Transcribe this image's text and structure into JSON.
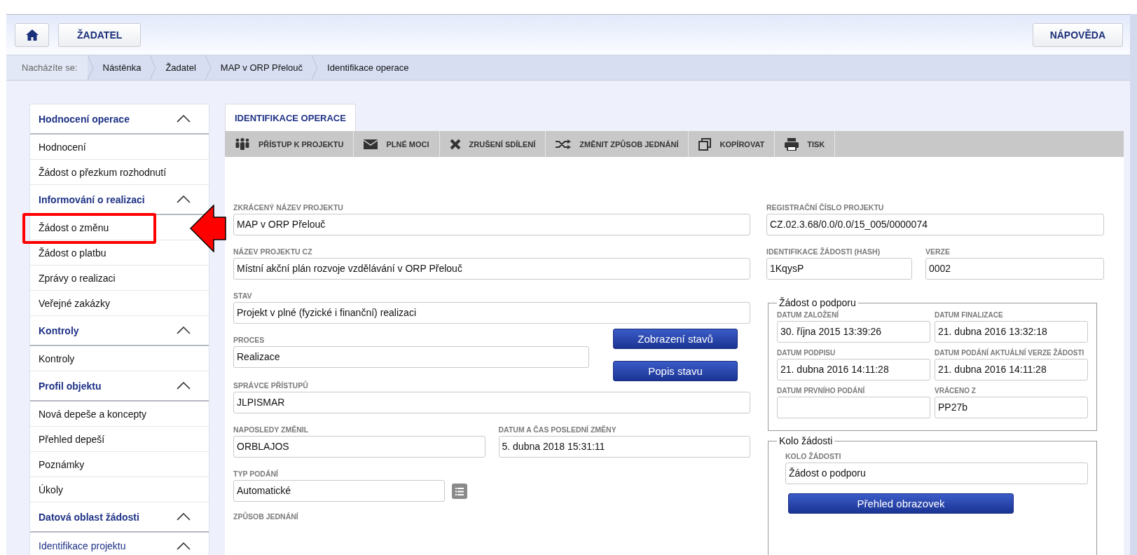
{
  "header": {
    "buttons": [
      "ŽADATEL"
    ],
    "help": "NÁPOVĚDA"
  },
  "breadcrumb": {
    "label": "Nacházíte se:",
    "items": [
      "Nástěnka",
      "Žadatel",
      "MAP v ORP Přelouč",
      "Identifikace operace"
    ]
  },
  "sidebar": {
    "sections": [
      {
        "title": "Hodnocení operace",
        "expanded": true,
        "items": [
          {
            "label": "Hodnocení",
            "highlighted": false
          },
          {
            "label": "Žádost o přezkum rozhodnutí",
            "highlighted": false
          }
        ]
      },
      {
        "title": "Informování o realizaci",
        "expanded": true,
        "items": [
          {
            "label": "Žádost o změnu",
            "highlighted": true
          },
          {
            "label": "Žádost o platbu",
            "highlighted": false
          },
          {
            "label": "Zprávy o realizaci",
            "highlighted": false
          },
          {
            "label": "Veřejné zakázky",
            "highlighted": false
          }
        ]
      },
      {
        "title": "Kontroly",
        "expanded": true,
        "items": [
          {
            "label": "Kontroly",
            "highlighted": false
          }
        ]
      },
      {
        "title": "Profil objektu",
        "expanded": true,
        "items": [
          {
            "label": "Nová depeše a koncepty",
            "highlighted": false
          },
          {
            "label": "Přehled depeší",
            "highlighted": false
          },
          {
            "label": "Poznámky",
            "highlighted": false
          },
          {
            "label": "Úkoly",
            "highlighted": false
          }
        ]
      },
      {
        "title": "Datová oblast žádosti",
        "expanded": true,
        "items": [
          {
            "label": "Identifikace projektu",
            "kind": "group",
            "expanded": true
          }
        ]
      }
    ]
  },
  "form": {
    "tab": "IDENTIFIKACE OPERACE",
    "toolbar": [
      "PŘÍSTUP K PROJEKTU",
      "PLNÉ MOCI",
      "ZRUŠENÍ SDÍLENÍ",
      "ZMĚNIT ZPŮSOB JEDNÁNÍ",
      "KOPÍROVAT",
      "TISK"
    ],
    "short_name": {
      "label": "ZKRÁCENÝ NÁZEV PROJEKTU",
      "value": "MAP v ORP Přelouč"
    },
    "name_cz": {
      "label": "NÁZEV PROJEKTU CZ",
      "value": "Místní akční plán rozvoje vzdělávání v ORP Přelouč"
    },
    "state": {
      "label": "STAV",
      "value": "Projekt v plné (fyzické i finanční) realizaci"
    },
    "process": {
      "label": "PROCES",
      "value": "Realizace"
    },
    "state_buttons": [
      "Zobrazení stavů",
      "Popis stavu"
    ],
    "access_manager": {
      "label": "SPRÁVCE PŘÍSTUPŮ",
      "value": "JLPISMAR"
    },
    "last_changed_by": {
      "label": "NAPOSLEDY ZMĚNIL",
      "value": "ORBLAJOS"
    },
    "last_change": {
      "label": "DATUM A ČAS POSLEDNÍ ZMĚNY",
      "value": "5. dubna 2018 15:31:11"
    },
    "submission_type": {
      "label": "TYP PODÁNÍ",
      "value": "Automatické"
    },
    "method_label": "ZPŮSOB JEDNÁNÍ",
    "reg_number": {
      "label": "REGISTRAČNÍ ČÍSLO PROJEKTU",
      "value": "CZ.02.3.68/0.0/0.0/15_005/0000074"
    },
    "request_hash": {
      "label": "IDENTIFIKACE ŽÁDOSTI (HASH)",
      "value": "1KqysP"
    },
    "version": {
      "label": "VERZE",
      "value": "0002"
    },
    "support": {
      "legend": "Žádost o podporu",
      "fields": [
        {
          "label": "DATUM ZALOŽENÍ",
          "value": "30. října 2015 13:39:26"
        },
        {
          "label": "DATUM FINALIZACE",
          "value": "21. dubna 2016 13:32:18"
        },
        {
          "label": "DATUM PODPISU",
          "value": "21. dubna 2016 14:11:28"
        },
        {
          "label": "DATUM PODÁNÍ AKTUÁLNÍ VERZE ŽÁDOSTI",
          "value": "21. dubna 2016 14:11:28"
        },
        {
          "label": "DATUM PRVNÍHO PODÁNÍ"
        },
        {
          "label": "VRÁCENO Z",
          "value": "PP27b"
        }
      ]
    },
    "round": {
      "legend": "Kolo žádosti",
      "field": {
        "label": "KOLO ŽÁDOSTI",
        "value": "Žádost o podporu"
      },
      "button": "Přehled obrazovek"
    }
  }
}
